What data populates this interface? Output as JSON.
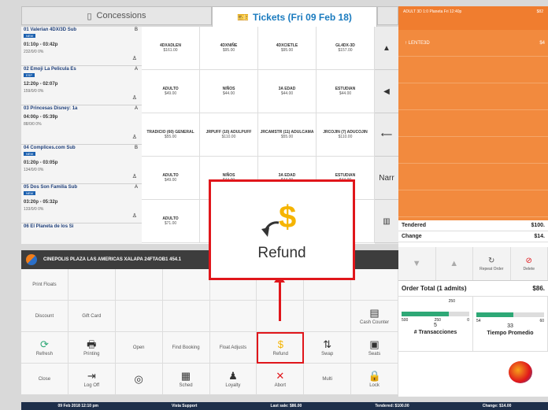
{
  "tabs": {
    "concessions": "Concessions",
    "tickets": "Tickets (Fri 09 Feb 18)"
  },
  "movies": [
    {
      "title": "01  Valerian 4DX/3D Sub",
      "rating": "B",
      "badge": "NEW",
      "time": "01:10p - 03:42p",
      "occ": "232/0/0  0%"
    },
    {
      "title": "02  Emoji La Pelicula Es",
      "rating": "A",
      "badge": "ESP",
      "time": "12:20p - 02:07p",
      "occ": "159/0/0  0%"
    },
    {
      "title": "03  Princesas Disney: 1a",
      "rating": "A",
      "badge": "",
      "time": "04:00p - 05:39p",
      "occ": "88/0/0  0%"
    },
    {
      "title": "04  Complices.com Sub",
      "rating": "B",
      "badge": "NEW",
      "time": "01:20p - 03:05p",
      "occ": "134/0/0  0%"
    },
    {
      "title": "05  Dos Son Familia Sub",
      "rating": "A",
      "badge": "NEW",
      "time": "03:20p - 05:32p",
      "occ": "133/0/0  0%"
    },
    {
      "title": "06  El Planeta de los Si",
      "rating": "",
      "badge": "",
      "time": "",
      "occ": ""
    }
  ],
  "tickets": [
    {
      "name": "4DXADLEN",
      "price": "$161.00"
    },
    {
      "name": "4DXNIÑE",
      "price": "$95.00"
    },
    {
      "name": "4DXCIETLE",
      "price": "$95.00"
    },
    {
      "name": "GL4DX-3D",
      "price": "$157.00"
    },
    {
      "name": "ADULTO",
      "price": "$49.00"
    },
    {
      "name": "NIÑOS",
      "price": "$44.00"
    },
    {
      "name": "3A EDAD",
      "price": "$44.00"
    },
    {
      "name": "ESTUDIAN",
      "price": "$44.00"
    },
    {
      "name": "TRADICIO (60) GENERAL",
      "price": "$55.00"
    },
    {
      "name": "JRPUFF (10) ADULPUFF",
      "price": "$110.00"
    },
    {
      "name": "JRCAMSTR (11) ADULCAMA",
      "price": "$55.00"
    },
    {
      "name": "JRCOJIN (7) ADUCOJIN",
      "price": "$110.00"
    },
    {
      "name": "ADULTO",
      "price": "$49.00"
    },
    {
      "name": "NIÑOS",
      "price": "$44.00"
    },
    {
      "name": "3A EDAD",
      "price": "$44.00"
    },
    {
      "name": "ESTUDIAN",
      "price": "$44.00"
    },
    {
      "name": "ADULTO",
      "price": "$71.00"
    },
    {
      "name": "",
      "price": ""
    },
    {
      "name": "",
      "price": ""
    },
    {
      "name": "",
      "price": ""
    }
  ],
  "sidenav": [
    "▲",
    "◀",
    "⟵",
    "Narr",
    "▥"
  ],
  "darkbar": {
    "text": "CINEPOLIS PLAZA LAS AMERICAS XALAPA  24FTAOB1  454.1"
  },
  "functions": [
    [
      "Print Floats",
      "",
      "",
      "",
      "",
      "",
      "",
      ""
    ],
    [
      "Discount",
      "Gift Card",
      "",
      "",
      "",
      "",
      "",
      "Cash Counter"
    ],
    [
      "Refresh",
      "Printing",
      "Open",
      "Find Booking",
      "Float Adjusts",
      "Refund",
      "Swap",
      "Seats"
    ],
    [
      "Close",
      "Log Off",
      "",
      "Sched",
      "Loyalty",
      "Abort",
      "Multi",
      "Lock"
    ]
  ],
  "icons": [
    [
      "",
      "",
      "",
      "",
      "",
      "",
      "",
      ""
    ],
    [
      "",
      "",
      "",
      "",
      "",
      "",
      "",
      "cash-register-icon"
    ],
    [
      "refresh-icon",
      "printer-icon",
      "",
      "",
      "",
      "refund-icon",
      "swap-icon",
      "seats-icon"
    ],
    [
      "",
      "logoff-icon",
      "camera-icon",
      "calendar-icon",
      "loyalty-icon",
      "abort-icon",
      "",
      "lock-icon"
    ]
  ],
  "order": {
    "header": "ADULT 3D  1:0  Planeta Fri 12:40p",
    "header_price": "$82",
    "line": "LENTE3D",
    "line_price": "$4",
    "tendered_label": "Tendered",
    "tendered_value": "$100.",
    "change_label": "Change",
    "change_value": "$14.",
    "repeat": "Repeat Order",
    "delete": "Delete",
    "total_label": "Order Total (1 admits)",
    "total_value": "$86."
  },
  "stats": {
    "left_marks": [
      "500",
      "250",
      "0"
    ],
    "left_value": "5",
    "left_label": "# Transacciones",
    "left_top": "250",
    "right_marks": [
      "54",
      "60"
    ],
    "right_value": "33",
    "right_label": "Tiempo Promedio",
    "left_fill": 0.7,
    "right_fill": 0.55
  },
  "popup": {
    "label": "Refund"
  },
  "status": [
    "09 Feb 2018 12:10 pm",
    "Vista Support",
    "Last sale: $86.00",
    "Tendered: $100.00",
    "Change: $14.00"
  ],
  "colors": {
    "accent": "#f28a3e",
    "highlight": "#e0161b",
    "tab_blue": "#1a7bbf"
  }
}
